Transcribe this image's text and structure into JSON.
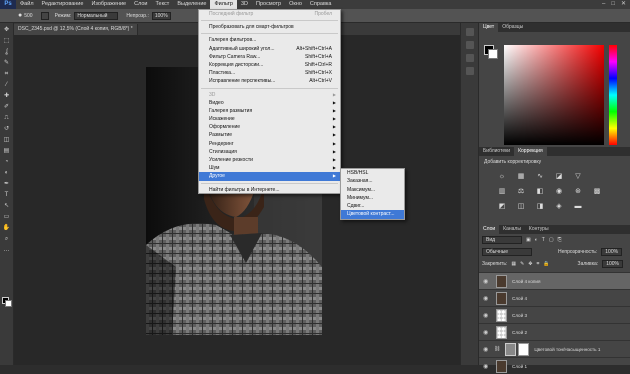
{
  "app": {
    "logo": "Ps"
  },
  "menubar": [
    "Файл",
    "Редактирование",
    "Изображение",
    "Слои",
    "Текст",
    "Выделение",
    "Фильтр",
    "3D",
    "Просмотр",
    "Окно",
    "Справка"
  ],
  "active_menu_index": 6,
  "window_controls": {
    "minimize": "–",
    "maximize": "□",
    "close": "✕"
  },
  "options": {
    "size": "500",
    "mode_label": "Режим:",
    "mode_value": "Нормальный",
    "opacity_label": "Непрозр.:",
    "opacity_value": "100%"
  },
  "document_tab": "DSC_2345.psd @ 12,5% (Слой 4 копия, RGB/8*) *",
  "filter_menu": {
    "items": [
      {
        "label": "Последний фильтр",
        "shortcut": "Пробел",
        "dim": true
      },
      {
        "sep": true
      },
      {
        "label": "Преобразовать для смарт-фильтров"
      },
      {
        "sep": true
      },
      {
        "label": "Галерея фильтров..."
      },
      {
        "label": "Адаптивный широкий угол...",
        "shortcut": "Alt+Shift+Ctrl+A"
      },
      {
        "label": "Фильтр Camera Raw...",
        "shortcut": "Shift+Ctrl+A"
      },
      {
        "label": "Коррекция дисторсии...",
        "shortcut": "Shift+Ctrl+R"
      },
      {
        "label": "Пластика...",
        "shortcut": "Shift+Ctrl+X"
      },
      {
        "label": "Исправление перспективы...",
        "shortcut": "Alt+Ctrl+V"
      },
      {
        "sep": true
      },
      {
        "label": "3D",
        "arrow": true,
        "dim": true
      },
      {
        "label": "Видео",
        "arrow": true
      },
      {
        "label": "Галерея размытия",
        "arrow": true
      },
      {
        "label": "Искажение",
        "arrow": true
      },
      {
        "label": "Оформление",
        "arrow": true
      },
      {
        "label": "Размытие",
        "arrow": true
      },
      {
        "label": "Рендеринг",
        "arrow": true
      },
      {
        "label": "Стилизация",
        "arrow": true
      },
      {
        "label": "Усиление резкости",
        "arrow": true
      },
      {
        "label": "Шум",
        "arrow": true
      },
      {
        "label": "Другое",
        "arrow": true,
        "highlight": true
      },
      {
        "sep": true
      },
      {
        "label": "Найти фильтры в Интернете..."
      }
    ]
  },
  "other_submenu": [
    "HSB/HSL",
    "Заказная...",
    "Максимум...",
    "Минимум...",
    "Сдвиг...",
    "Цветовой контраст..."
  ],
  "other_submenu_highlight_index": 5,
  "color_panel": {
    "tabs": [
      "Цвет",
      "Образцы"
    ],
    "foreground": "#000000",
    "background": "#ffffff",
    "accent": "#f20000"
  },
  "adjustments_panel": {
    "tabs": [
      "Библиотеки",
      "Коррекция"
    ],
    "add_label": "Добавить корректировку"
  },
  "layers_panel": {
    "tabs": [
      "Слои",
      "Каналы",
      "Контуры"
    ],
    "kind_label": "Вид",
    "blend_mode": "Обычные",
    "opacity_label": "Непрозрачность:",
    "opacity_value": "100%",
    "lock_label": "Закрепить:",
    "fill_label": "Заливка:",
    "fill_value": "100%",
    "layers": [
      {
        "name": "Слой 4 копия",
        "thumb": "img",
        "selected": true
      },
      {
        "name": "Слой 4",
        "thumb": "img"
      },
      {
        "name": "Слой 3",
        "thumb": "tr"
      },
      {
        "name": "Слой 2",
        "thumb": "tr"
      },
      {
        "name": "Цветовой тон/Насыщенность 1",
        "thumb": "adj",
        "mask": true,
        "indent": true
      },
      {
        "name": "Слой 1",
        "thumb": "img"
      }
    ]
  }
}
